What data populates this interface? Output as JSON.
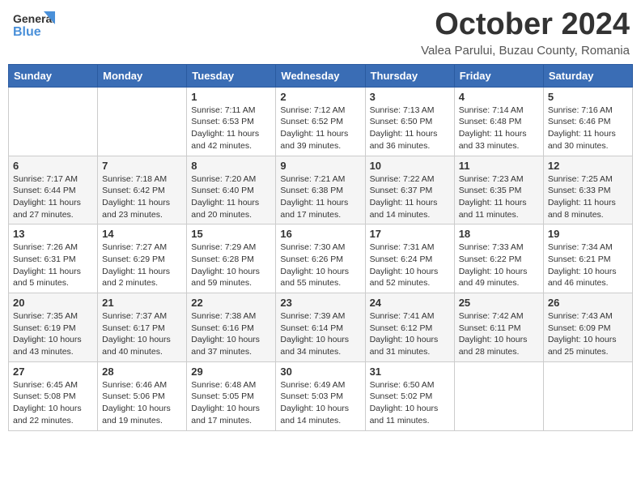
{
  "header": {
    "logo_line1": "General",
    "logo_line2": "Blue",
    "month_title": "October 2024",
    "location": "Valea Parului, Buzau County, Romania"
  },
  "weekdays": [
    "Sunday",
    "Monday",
    "Tuesday",
    "Wednesday",
    "Thursday",
    "Friday",
    "Saturday"
  ],
  "weeks": [
    [
      {
        "day": "",
        "info": ""
      },
      {
        "day": "",
        "info": ""
      },
      {
        "day": "1",
        "info": "Sunrise: 7:11 AM\nSunset: 6:53 PM\nDaylight: 11 hours and 42 minutes."
      },
      {
        "day": "2",
        "info": "Sunrise: 7:12 AM\nSunset: 6:52 PM\nDaylight: 11 hours and 39 minutes."
      },
      {
        "day": "3",
        "info": "Sunrise: 7:13 AM\nSunset: 6:50 PM\nDaylight: 11 hours and 36 minutes."
      },
      {
        "day": "4",
        "info": "Sunrise: 7:14 AM\nSunset: 6:48 PM\nDaylight: 11 hours and 33 minutes."
      },
      {
        "day": "5",
        "info": "Sunrise: 7:16 AM\nSunset: 6:46 PM\nDaylight: 11 hours and 30 minutes."
      }
    ],
    [
      {
        "day": "6",
        "info": "Sunrise: 7:17 AM\nSunset: 6:44 PM\nDaylight: 11 hours and 27 minutes."
      },
      {
        "day": "7",
        "info": "Sunrise: 7:18 AM\nSunset: 6:42 PM\nDaylight: 11 hours and 23 minutes."
      },
      {
        "day": "8",
        "info": "Sunrise: 7:20 AM\nSunset: 6:40 PM\nDaylight: 11 hours and 20 minutes."
      },
      {
        "day": "9",
        "info": "Sunrise: 7:21 AM\nSunset: 6:38 PM\nDaylight: 11 hours and 17 minutes."
      },
      {
        "day": "10",
        "info": "Sunrise: 7:22 AM\nSunset: 6:37 PM\nDaylight: 11 hours and 14 minutes."
      },
      {
        "day": "11",
        "info": "Sunrise: 7:23 AM\nSunset: 6:35 PM\nDaylight: 11 hours and 11 minutes."
      },
      {
        "day": "12",
        "info": "Sunrise: 7:25 AM\nSunset: 6:33 PM\nDaylight: 11 hours and 8 minutes."
      }
    ],
    [
      {
        "day": "13",
        "info": "Sunrise: 7:26 AM\nSunset: 6:31 PM\nDaylight: 11 hours and 5 minutes."
      },
      {
        "day": "14",
        "info": "Sunrise: 7:27 AM\nSunset: 6:29 PM\nDaylight: 11 hours and 2 minutes."
      },
      {
        "day": "15",
        "info": "Sunrise: 7:29 AM\nSunset: 6:28 PM\nDaylight: 10 hours and 59 minutes."
      },
      {
        "day": "16",
        "info": "Sunrise: 7:30 AM\nSunset: 6:26 PM\nDaylight: 10 hours and 55 minutes."
      },
      {
        "day": "17",
        "info": "Sunrise: 7:31 AM\nSunset: 6:24 PM\nDaylight: 10 hours and 52 minutes."
      },
      {
        "day": "18",
        "info": "Sunrise: 7:33 AM\nSunset: 6:22 PM\nDaylight: 10 hours and 49 minutes."
      },
      {
        "day": "19",
        "info": "Sunrise: 7:34 AM\nSunset: 6:21 PM\nDaylight: 10 hours and 46 minutes."
      }
    ],
    [
      {
        "day": "20",
        "info": "Sunrise: 7:35 AM\nSunset: 6:19 PM\nDaylight: 10 hours and 43 minutes."
      },
      {
        "day": "21",
        "info": "Sunrise: 7:37 AM\nSunset: 6:17 PM\nDaylight: 10 hours and 40 minutes."
      },
      {
        "day": "22",
        "info": "Sunrise: 7:38 AM\nSunset: 6:16 PM\nDaylight: 10 hours and 37 minutes."
      },
      {
        "day": "23",
        "info": "Sunrise: 7:39 AM\nSunset: 6:14 PM\nDaylight: 10 hours and 34 minutes."
      },
      {
        "day": "24",
        "info": "Sunrise: 7:41 AM\nSunset: 6:12 PM\nDaylight: 10 hours and 31 minutes."
      },
      {
        "day": "25",
        "info": "Sunrise: 7:42 AM\nSunset: 6:11 PM\nDaylight: 10 hours and 28 minutes."
      },
      {
        "day": "26",
        "info": "Sunrise: 7:43 AM\nSunset: 6:09 PM\nDaylight: 10 hours and 25 minutes."
      }
    ],
    [
      {
        "day": "27",
        "info": "Sunrise: 6:45 AM\nSunset: 5:08 PM\nDaylight: 10 hours and 22 minutes."
      },
      {
        "day": "28",
        "info": "Sunrise: 6:46 AM\nSunset: 5:06 PM\nDaylight: 10 hours and 19 minutes."
      },
      {
        "day": "29",
        "info": "Sunrise: 6:48 AM\nSunset: 5:05 PM\nDaylight: 10 hours and 17 minutes."
      },
      {
        "day": "30",
        "info": "Sunrise: 6:49 AM\nSunset: 5:03 PM\nDaylight: 10 hours and 14 minutes."
      },
      {
        "day": "31",
        "info": "Sunrise: 6:50 AM\nSunset: 5:02 PM\nDaylight: 10 hours and 11 minutes."
      },
      {
        "day": "",
        "info": ""
      },
      {
        "day": "",
        "info": ""
      }
    ]
  ]
}
